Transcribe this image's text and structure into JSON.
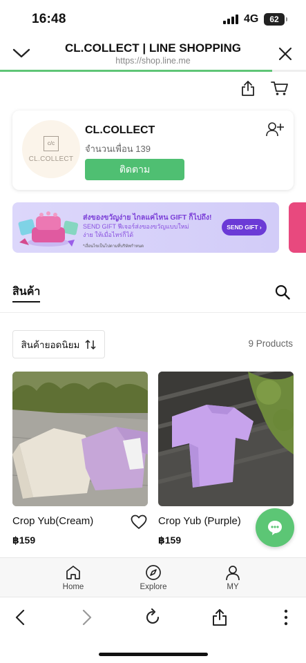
{
  "status_bar": {
    "time": "16:48",
    "network": "4G",
    "battery": "62"
  },
  "header": {
    "title": "CL.COLLECT | LINE SHOPPING",
    "url": "https://shop.line.me"
  },
  "shop": {
    "logo_text": "CL.COLLECT",
    "logo_mark": "c/c",
    "name": "CL.COLLECT",
    "friends_label": "จำนวนเพื่อน 139",
    "follow_label": "ติดตาม"
  },
  "banner": {
    "headline": "ส่งของขวัญง่าย ไกลแค่ไหน GIFT ก็ไปถึง!",
    "sub_line1": "SEND GIFT ฟีเจอร์ส่งของขวัญแบบใหม่",
    "sub_line2": "ง่าย ให้เมื่อไหร่ก็ได้",
    "note": "*เงื่อนไขเป็นไปตามที่บริษัทกำหนด",
    "button_label": "SEND GIFT ›"
  },
  "tabs": {
    "products_label": "สินค้า"
  },
  "sort": {
    "label": "สินค้ายอดนิยม",
    "count_label": "9 Products"
  },
  "products": [
    {
      "name": "Crop Yub(Cream)",
      "price": "฿159"
    },
    {
      "name": "Crop Yub (Purple)",
      "price": "฿159"
    }
  ],
  "app_nav": [
    {
      "label": "Home",
      "icon": "home-icon"
    },
    {
      "label": "Explore",
      "icon": "compass-icon"
    },
    {
      "label": "MY",
      "icon": "person-icon"
    }
  ],
  "colors": {
    "accent": "#4fbf72",
    "banner_purple": "#6b3ad6",
    "progress": "#5ec576"
  },
  "progress": {
    "value": 0.89
  }
}
